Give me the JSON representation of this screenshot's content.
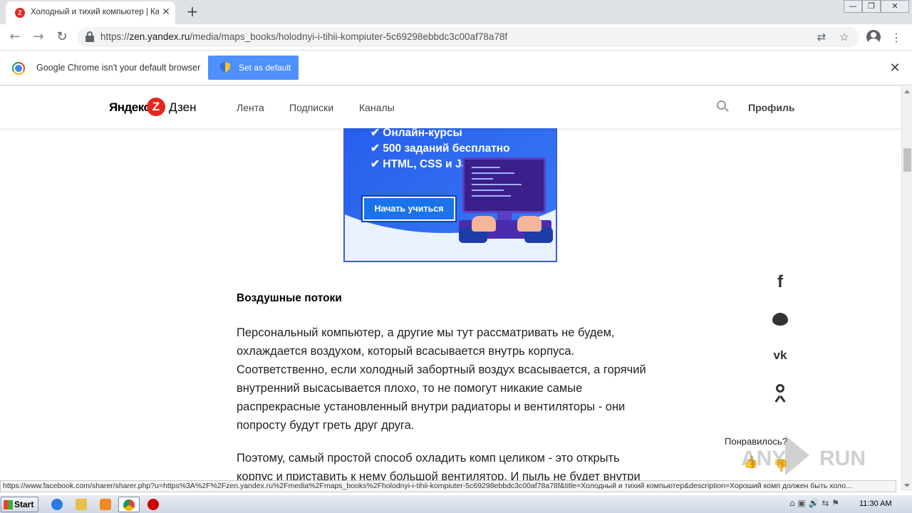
{
  "browser": {
    "tab": {
      "title": "Холодный и тихий компьютер | Ка",
      "favicon": "Z"
    },
    "new_tab_glyph": "+",
    "url": {
      "scheme": "https://",
      "host": "zen.yandex.ru",
      "path": "/media/maps_books/holodnyi-i-tihii-kompiuter-5c69298ebbdc3c00af78a78f"
    },
    "window_controls": {
      "minimize": "—",
      "restore": "❐",
      "close": "✕"
    }
  },
  "infobar": {
    "message": "Google Chrome isn't your default browser",
    "button_label": "Set as default"
  },
  "zen": {
    "logo_word1": "Яндекс",
    "logo_z": "Z",
    "logo_word2": "Дзен",
    "nav": [
      "Лента",
      "Подписки",
      "Каналы"
    ],
    "profile": "Профиль"
  },
  "banner": {
    "bullets": [
      "✔ Онлайн-курсы",
      "✔ 500 заданий бесплатно",
      "✔ HTML, CSS и JavaScript"
    ],
    "cta": "Начать учиться"
  },
  "article": {
    "heading": "Воздушные потоки",
    "para1": [
      "Персональный компьютер, а другие мы тут рассматривать не будем,",
      "охлаждается воздухом, который всасывается внутрь корпуса.",
      "Соответственно, если холодный забортный воздух всасывается, а горячий",
      "внутренний высасывается плохо, то не помогут никакие самые",
      "распрекрасные установленный внутри радиаторы и вентиляторы - они",
      "попросту будут греть друг друга."
    ],
    "para2": [
      "Поэтому, самый простой способ охладить комп целиком - это открыть",
      "корпус и приставить к нему большой вентилятор. И пыль не будет внутри"
    ]
  },
  "share": {
    "facebook_glyph": "f",
    "vk_glyph": "vk",
    "liked_label": "Понравилось?",
    "like_glyph": "👍",
    "dislike_glyph": "👎"
  },
  "watermark": {
    "left": "ANY",
    "right": "RUN"
  },
  "status_url": "https://www.facebook.com/sharer/sharer.php?u=https%3A%2F%2Fzen.yandex.ru%2Fmedia%2Fmaps_books%2Fholodnyi-i-tihii-kompiuter-5c69298ebbdc3c00af78a78f&title=Холодный и тихий компьютер&description=Хороший комп должен быть холо...",
  "taskbar": {
    "start_label": "Start",
    "clock": "11:30 AM"
  },
  "colors": {
    "zen_red": "#e52620",
    "chrome_blue_button": "#4d90fe",
    "tab_strip": "#dee1e6"
  }
}
